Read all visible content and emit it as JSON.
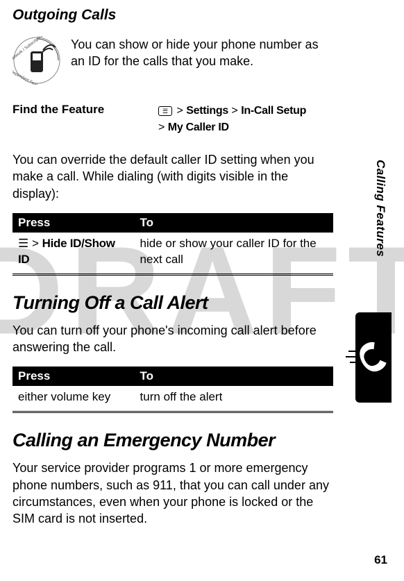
{
  "watermark": "DRAFT",
  "sidebar": {
    "section_label": "Calling Features"
  },
  "section1": {
    "heading": "Outgoing Calls",
    "intro": "You can show or hide your phone number as an ID for the calls that you make.",
    "find_feature_label": "Find the Feature",
    "menu_glyph": "☰",
    "path_sep": ">",
    "path_settings": "Settings",
    "path_incall": "In-Call Setup",
    "path_mycallerid": "My Caller ID",
    "override_para": "You can override the default caller ID setting when you make a call. While dialing (with digits visible in the display):",
    "table": {
      "head_press": "Press",
      "head_to": "To",
      "row1_press": "Hide ID/Show ID",
      "row1_to": "hide or show your caller ID for the next call"
    }
  },
  "section2": {
    "heading": "Turning Off a Call Alert",
    "intro": "You can turn off your phone's incoming call alert before answering the call.",
    "table": {
      "head_press": "Press",
      "head_to": "To",
      "row1_press": "either volume key",
      "row1_to": "turn off the alert"
    }
  },
  "section3": {
    "heading": "Calling an Emergency Number",
    "intro": "Your service provider programs 1 or more emergency phone numbers, such as 911, that you can call under any circumstances, even when your phone is locked or the SIM card is not inserted."
  },
  "page_number": "61"
}
